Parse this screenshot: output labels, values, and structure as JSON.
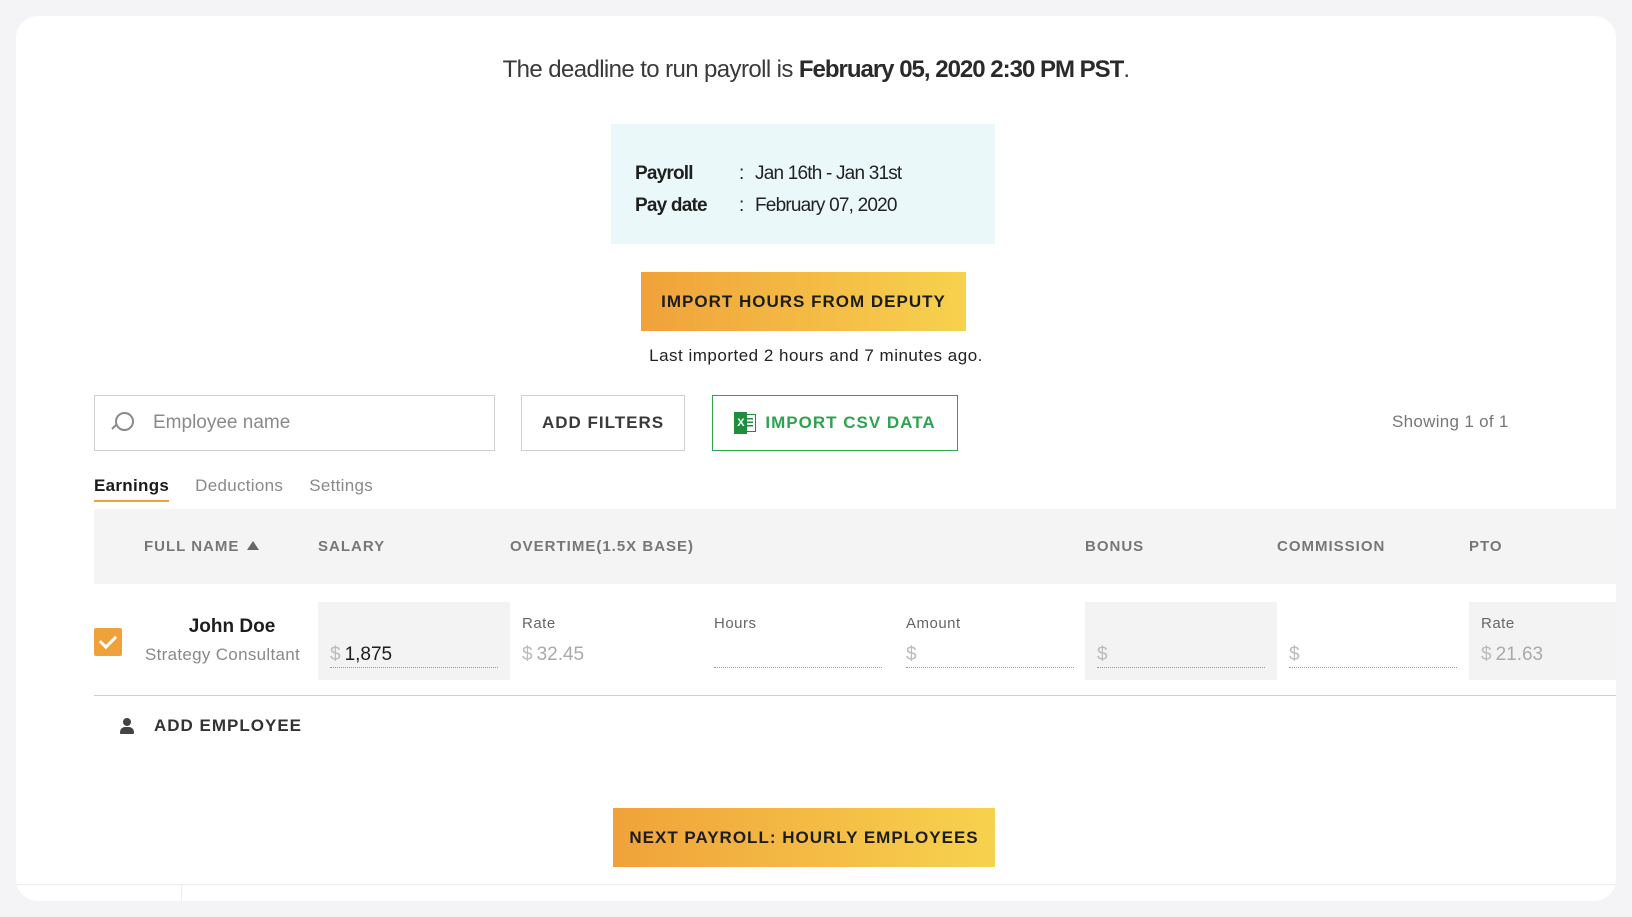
{
  "header": {
    "deadline_prefix": "The deadline to run payroll is ",
    "deadline_value": "February 05, 2020 2:30 PM PST",
    "deadline_suffix": "."
  },
  "payroll_info": {
    "payroll_label": "Payroll",
    "payroll_value": "Jan 16th - Jan 31st",
    "paydate_label": "Pay date",
    "paydate_value": "February 07, 2020",
    "separator": ":"
  },
  "deputy": {
    "button_label": "IMPORT HOURS FROM DEPUTY",
    "last_imported": "Last imported 2 hours and 7 minutes ago."
  },
  "toolbar": {
    "search_placeholder": "Employee name",
    "search_value": "",
    "add_filters_label": "ADD FILTERS",
    "import_csv_label": "IMPORT CSV DATA",
    "showing": "Showing 1 of 1"
  },
  "tabs": [
    {
      "label": "Earnings",
      "active": true
    },
    {
      "label": "Deductions",
      "active": false
    },
    {
      "label": "Settings",
      "active": false
    }
  ],
  "table": {
    "columns": {
      "full_name": "FULL NAME",
      "salary": "SALARY",
      "overtime": "OVERTIME(1.5X BASE)",
      "bonus": "BONUS",
      "commission": "COMMISSION",
      "pto": "PTO"
    },
    "row": {
      "checked": true,
      "name": "John Doe",
      "title": "Strategy Consultant",
      "currency": "$",
      "salary": "1,875",
      "overtime_rate_label": "Rate",
      "overtime_rate": "32.45",
      "overtime_hours_label": "Hours",
      "overtime_amount_label": "Amount",
      "pto_rate_label": "Rate",
      "pto_rate": "21.63"
    }
  },
  "actions": {
    "add_employee": "ADD EMPLOYEE",
    "next_payroll": "NEXT PAYROLL: HOURLY EMPLOYEES"
  },
  "colors": {
    "accent_gradient_start": "#f0a23a",
    "accent_gradient_end": "#f7d24e",
    "csv_green": "#2ea44f",
    "info_box_bg": "#ebf8fa"
  }
}
